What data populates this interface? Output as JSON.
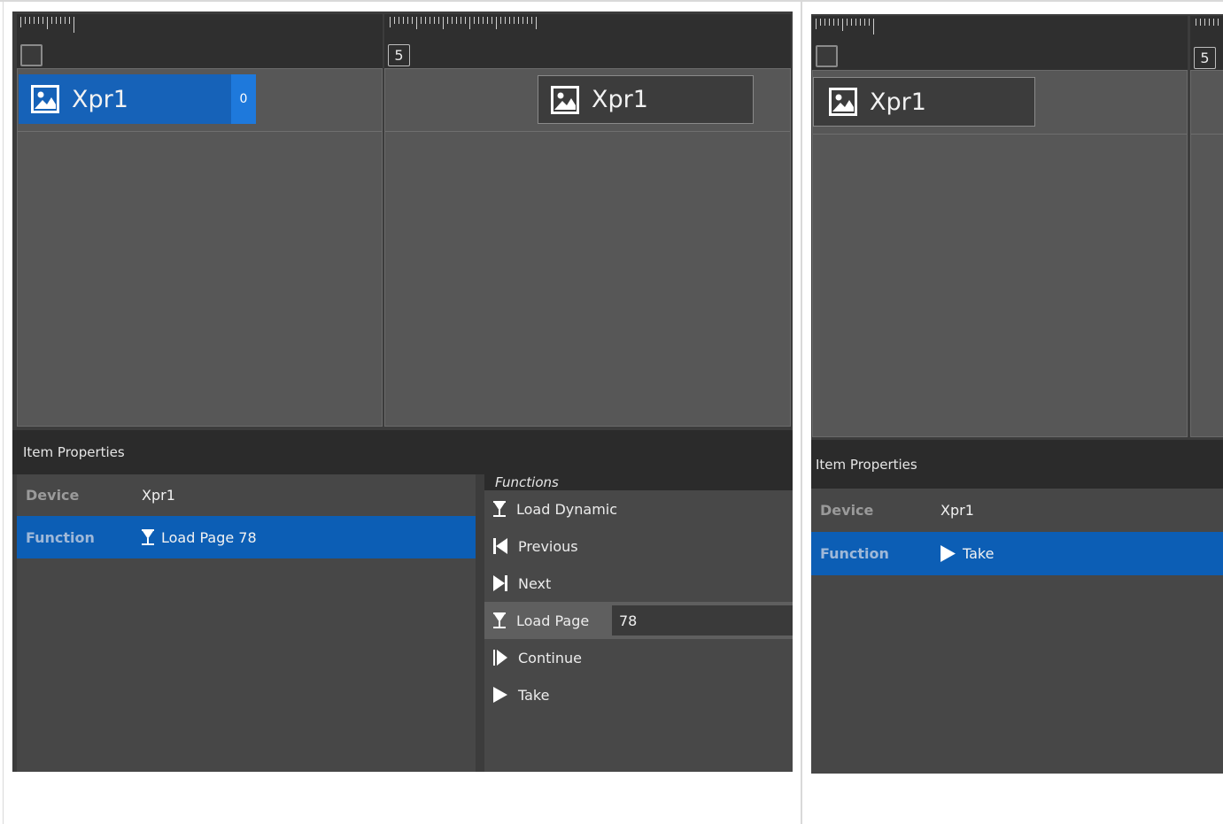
{
  "left": {
    "track_a": {
      "frame_number": "",
      "clip": {
        "name": "Xpr1",
        "badge": "0"
      }
    },
    "track_b": {
      "frame_number": "5",
      "clip": {
        "name": "Xpr1"
      }
    },
    "item_properties": {
      "title": "Item Properties",
      "rows": [
        {
          "label": "Device",
          "value": "Xpr1",
          "icon": ""
        },
        {
          "label": "Function",
          "value": "Load Page 78",
          "icon": "load-page-icon"
        }
      ],
      "selected_row": 1
    },
    "functions": {
      "title": "Functions",
      "items": [
        {
          "label": "Load Dynamic",
          "icon": "load-dynamic-icon"
        },
        {
          "label": "Previous",
          "icon": "previous-icon"
        },
        {
          "label": "Next",
          "icon": "next-icon"
        },
        {
          "label": "Load Page",
          "icon": "load-page-icon",
          "param": "78"
        },
        {
          "label": "Continue",
          "icon": "continue-icon"
        },
        {
          "label": "Take",
          "icon": "play-icon"
        }
      ],
      "selected_index": 3
    }
  },
  "right": {
    "track_a": {
      "clip": {
        "name": "Xpr1"
      }
    },
    "track_b": {
      "frame_number": "5"
    },
    "item_properties": {
      "title": "Item Properties",
      "rows": [
        {
          "label": "Device",
          "value": "Xpr1",
          "icon": ""
        },
        {
          "label": "Function",
          "value": "Take",
          "icon": "play-icon"
        }
      ],
      "selected_row": 1
    }
  },
  "colors": {
    "selection_blue": "#0c5eb5",
    "clip_selected": "#1662b8",
    "panel_dark": "#2b2b2b",
    "track_gray": "#575757"
  }
}
